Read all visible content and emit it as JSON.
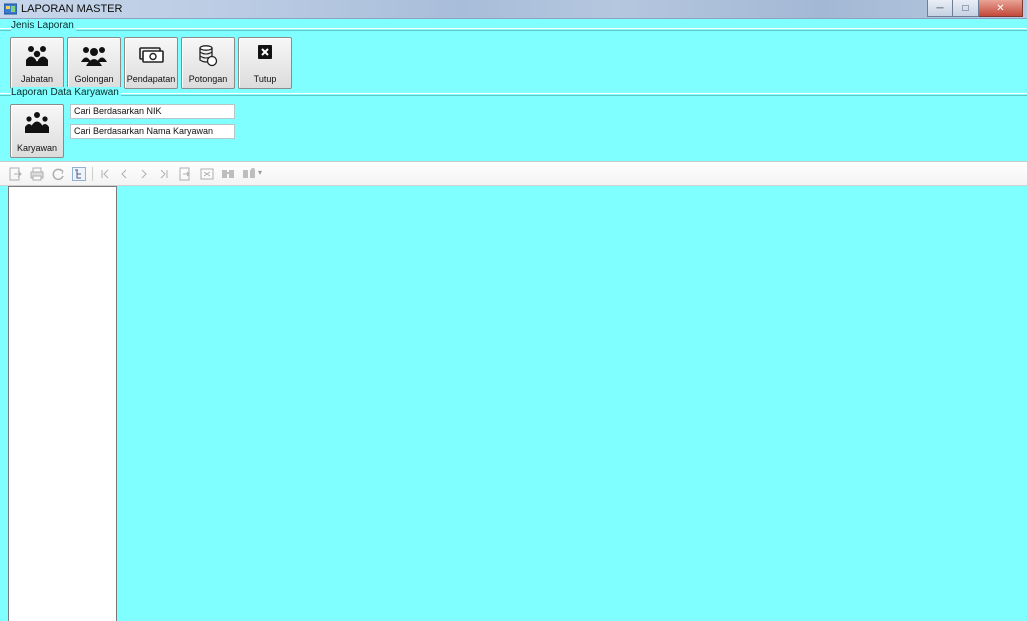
{
  "window": {
    "title": "LAPORAN MASTER",
    "controls": [
      "minimize",
      "maximize",
      "close"
    ]
  },
  "jenis_laporan": {
    "label": "Jenis Laporan",
    "buttons": [
      {
        "label": "Jabatan",
        "icon": "people-group-icon"
      },
      {
        "label": "Golongan",
        "icon": "users-icon"
      },
      {
        "label": "Pendapatan",
        "icon": "money-icon"
      },
      {
        "label": "Potongan",
        "icon": "coins-icon"
      },
      {
        "label": "Tutup",
        "icon": "close-square-icon"
      }
    ]
  },
  "laporan_karyawan": {
    "label": "Laporan Data Karyawan",
    "button": {
      "label": "Karyawan",
      "icon": "employees-icon"
    },
    "fields": [
      {
        "value": "Cari Berdasarkan NIK"
      },
      {
        "value": "Cari Berdasarkan Nama Karyawan"
      }
    ]
  },
  "report_toolbar": {
    "icons": [
      "export-icon",
      "print-icon",
      "refresh-icon",
      "toggle-group-tree-icon",
      "first-page-icon",
      "previous-page-icon",
      "next-page-icon",
      "last-page-icon",
      "go-to-page-icon",
      "close-view-icon",
      "find-icon",
      "zoom-icon"
    ]
  },
  "colors": {
    "background": "#7fffff",
    "panel": "#ffffff"
  }
}
